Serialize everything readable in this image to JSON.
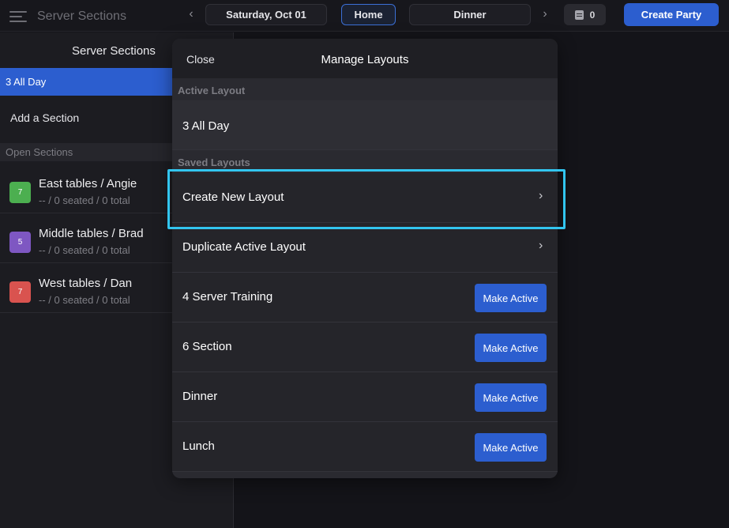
{
  "app": {
    "title": "Server Sections"
  },
  "topbar": {
    "date_label": "Saturday, Oct 01",
    "home_label": "Home",
    "meal_label": "Dinner",
    "count": "0",
    "create_party_label": "Create Party"
  },
  "sidebar": {
    "title": "Server Sections",
    "active_layout": "3 All Day",
    "add_section": "Add a Section",
    "open_sections_header": "Open Sections",
    "sections": [
      {
        "badge": "7",
        "name": "East tables / Angie",
        "stats": "-- / 0 seated / 0 total",
        "color": "#4caf50"
      },
      {
        "badge": "5",
        "name": "Middle tables / Brad",
        "stats": "-- / 0 seated / 0 total",
        "color": "#7e57c2"
      },
      {
        "badge": "7",
        "name": "West tables / Dan",
        "stats": "-- / 0 seated / 0 total",
        "color": "#d9534f"
      }
    ]
  },
  "modal": {
    "close_label": "Close",
    "title": "Manage Layouts",
    "active_header": "Active Layout",
    "active_layout": "3 All Day",
    "saved_header": "Saved Layouts",
    "actions": [
      {
        "label": "Create New Layout"
      },
      {
        "label": "Duplicate Active Layout"
      }
    ],
    "make_active_label": "Make Active",
    "saved_layouts": [
      {
        "label": "4 Server Training"
      },
      {
        "label": "6 Section"
      },
      {
        "label": "Dinner"
      },
      {
        "label": "Lunch"
      }
    ]
  },
  "colors": {
    "accent": "#2c5ecf",
    "highlight": "#32c5ef"
  }
}
